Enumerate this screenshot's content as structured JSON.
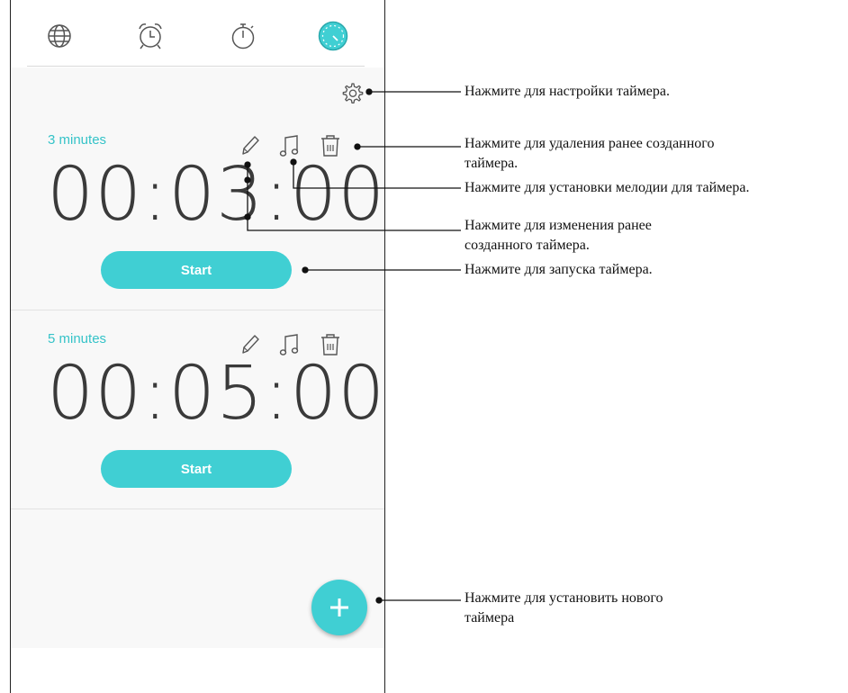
{
  "tabs": [
    {
      "name": "world-clock",
      "icon": "globe-icon",
      "active": false
    },
    {
      "name": "alarm",
      "icon": "alarm-clock-icon",
      "active": false
    },
    {
      "name": "stopwatch",
      "icon": "stopwatch-icon",
      "active": false
    },
    {
      "name": "timer",
      "icon": "timer-icon",
      "active": true
    }
  ],
  "settings_icon": "gear-icon",
  "timers": [
    {
      "label": "3 minutes",
      "time": "00:03:00",
      "start_label": "Start"
    },
    {
      "label": "5 minutes",
      "time": "00:05:00",
      "start_label": "Start"
    }
  ],
  "card_icons": [
    "pencil-icon",
    "music-note-icon",
    "trash-icon"
  ],
  "fab_icon": "plus-icon",
  "annotations": {
    "settings": "Нажмите для настройки таймера.",
    "delete_line1": "Нажмите для удаления ранее созданного",
    "delete_line2": "таймера.",
    "melody": "Нажмите для установки мелодии для таймера.",
    "edit_line1": "Нажмите для изменения ранее",
    "edit_line2": "созданного таймера.",
    "start": "Нажмите для запуска таймера.",
    "add_line1": "Нажмите для установить нового",
    "add_line2": "таймера"
  },
  "colors": {
    "accent": "#40cfd3",
    "label": "#35c3c8",
    "text": "#3a3a3a",
    "icon": "#555555"
  }
}
